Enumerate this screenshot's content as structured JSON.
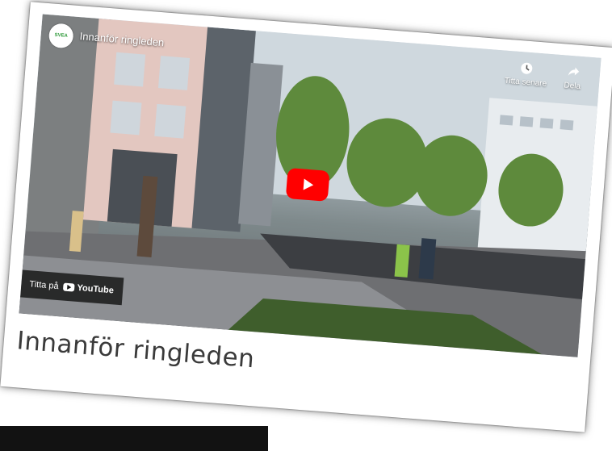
{
  "video": {
    "title": "Innanför ringleden",
    "channel_logo_text": "SVEA",
    "watch_later_label": "Titta senare",
    "share_label": "Dela",
    "watch_on_label": "Titta på",
    "youtube_label": "YouTube",
    "play_button_color": "#ff0000"
  },
  "caption": {
    "title": "Innanför ringleden"
  },
  "colors": {
    "card_background": "#ffffff",
    "caption_text": "#3a3a3a",
    "overlay_bar": "#141414"
  },
  "icons": {
    "watch_later": "clock-icon",
    "share": "share-arrow-icon",
    "play": "play-icon",
    "youtube": "youtube-logo-icon"
  }
}
